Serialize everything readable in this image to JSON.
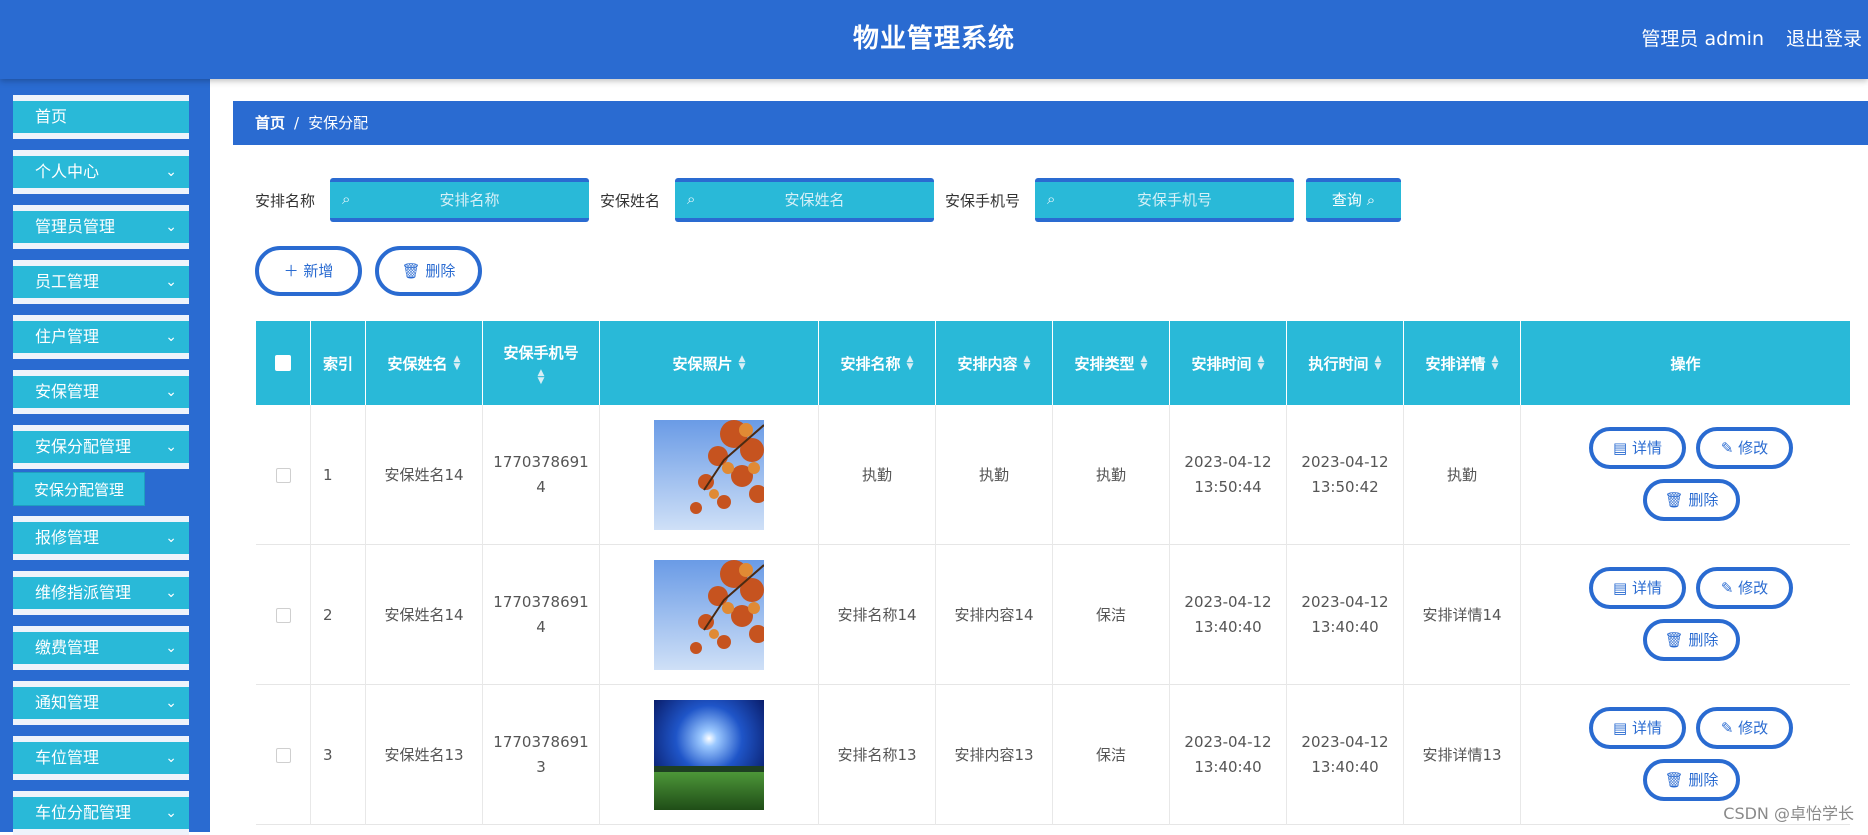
{
  "header": {
    "title": "物业管理系统",
    "user": "管理员 admin",
    "logout": "退出登录"
  },
  "sidebar": {
    "items": [
      {
        "label": "首页",
        "chevron": false
      },
      {
        "label": "个人中心",
        "chevron": true
      },
      {
        "label": "管理员管理",
        "chevron": true
      },
      {
        "label": "员工管理",
        "chevron": true
      },
      {
        "label": "住户管理",
        "chevron": true
      },
      {
        "label": "安保管理",
        "chevron": true
      },
      {
        "label": "安保分配管理",
        "chevron": true
      },
      {
        "label": "报修管理",
        "chevron": true
      },
      {
        "label": "维修指派管理",
        "chevron": true
      },
      {
        "label": "缴费管理",
        "chevron": true
      },
      {
        "label": "通知管理",
        "chevron": true
      },
      {
        "label": "车位管理",
        "chevron": true
      },
      {
        "label": "车位分配管理",
        "chevron": true
      }
    ],
    "active_sub": "安保分配管理"
  },
  "breadcrumb": {
    "home": "首页",
    "separator": "/",
    "current": "安保分配"
  },
  "search": {
    "fields": [
      {
        "label": "安排名称",
        "placeholder": "安排名称"
      },
      {
        "label": "安保姓名",
        "placeholder": "安保姓名"
      },
      {
        "label": "安保手机号",
        "placeholder": "安保手机号"
      }
    ],
    "query_label": "查询"
  },
  "actions": {
    "add_label": "新增",
    "delete_label": "删除"
  },
  "table": {
    "headers": [
      "索引",
      "安保姓名",
      "安保手机号",
      "安保照片",
      "安排名称",
      "安排内容",
      "安排类型",
      "安排时间",
      "执行时间",
      "安排详情",
      "操作"
    ],
    "rows": [
      {
        "index": "1",
        "name": "安保姓名14",
        "phone1": "1770378691",
        "phone2": "4",
        "photo": "autumn-leaves",
        "plan_name": "执勤",
        "plan_content": "执勤",
        "plan_type": "执勤",
        "plan_time_date": "2023-04-12",
        "plan_time_clock": "13:50:44",
        "exec_time_date": "2023-04-12",
        "exec_time_clock": "13:50:42",
        "detail": "执勤"
      },
      {
        "index": "2",
        "name": "安保姓名14",
        "phone1": "1770378691",
        "phone2": "4",
        "photo": "autumn-leaves",
        "plan_name": "安排名称14",
        "plan_content": "安排内容14",
        "plan_type": "保洁",
        "plan_time_date": "2023-04-12",
        "plan_time_clock": "13:40:40",
        "exec_time_date": "2023-04-12",
        "exec_time_clock": "13:40:40",
        "detail": "安排详情14"
      },
      {
        "index": "3",
        "name": "安保姓名13",
        "phone1": "1770378691",
        "phone2": "3",
        "photo": "sunny-meadow",
        "plan_name": "安排名称13",
        "plan_content": "安排内容13",
        "plan_type": "保洁",
        "plan_time_date": "2023-04-12",
        "plan_time_clock": "13:40:40",
        "exec_time_date": "2023-04-12",
        "exec_time_clock": "13:40:40",
        "detail": "安排详情13"
      }
    ],
    "op_labels": {
      "detail": "详情",
      "edit": "修改",
      "delete": "删除"
    }
  },
  "watermark": "CSDN @卓怡学长",
  "colors": {
    "header_blue": "#2a6bd1",
    "accent_cyan": "#29b9d8"
  }
}
